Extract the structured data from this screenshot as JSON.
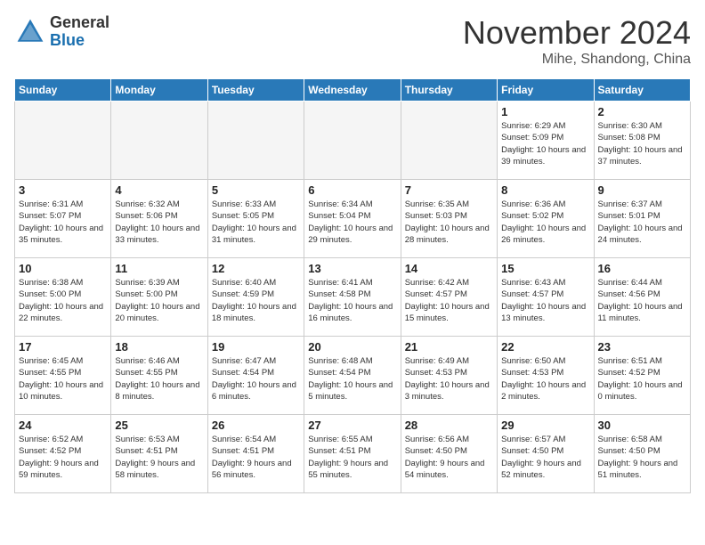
{
  "logo": {
    "general": "General",
    "blue": "Blue"
  },
  "header": {
    "month": "November 2024",
    "location": "Mihe, Shandong, China"
  },
  "days_of_week": [
    "Sunday",
    "Monday",
    "Tuesday",
    "Wednesday",
    "Thursday",
    "Friday",
    "Saturday"
  ],
  "weeks": [
    [
      {
        "day": "",
        "info": ""
      },
      {
        "day": "",
        "info": ""
      },
      {
        "day": "",
        "info": ""
      },
      {
        "day": "",
        "info": ""
      },
      {
        "day": "",
        "info": ""
      },
      {
        "day": "1",
        "info": "Sunrise: 6:29 AM\nSunset: 5:09 PM\nDaylight: 10 hours and 39 minutes."
      },
      {
        "day": "2",
        "info": "Sunrise: 6:30 AM\nSunset: 5:08 PM\nDaylight: 10 hours and 37 minutes."
      }
    ],
    [
      {
        "day": "3",
        "info": "Sunrise: 6:31 AM\nSunset: 5:07 PM\nDaylight: 10 hours and 35 minutes."
      },
      {
        "day": "4",
        "info": "Sunrise: 6:32 AM\nSunset: 5:06 PM\nDaylight: 10 hours and 33 minutes."
      },
      {
        "day": "5",
        "info": "Sunrise: 6:33 AM\nSunset: 5:05 PM\nDaylight: 10 hours and 31 minutes."
      },
      {
        "day": "6",
        "info": "Sunrise: 6:34 AM\nSunset: 5:04 PM\nDaylight: 10 hours and 29 minutes."
      },
      {
        "day": "7",
        "info": "Sunrise: 6:35 AM\nSunset: 5:03 PM\nDaylight: 10 hours and 28 minutes."
      },
      {
        "day": "8",
        "info": "Sunrise: 6:36 AM\nSunset: 5:02 PM\nDaylight: 10 hours and 26 minutes."
      },
      {
        "day": "9",
        "info": "Sunrise: 6:37 AM\nSunset: 5:01 PM\nDaylight: 10 hours and 24 minutes."
      }
    ],
    [
      {
        "day": "10",
        "info": "Sunrise: 6:38 AM\nSunset: 5:00 PM\nDaylight: 10 hours and 22 minutes."
      },
      {
        "day": "11",
        "info": "Sunrise: 6:39 AM\nSunset: 5:00 PM\nDaylight: 10 hours and 20 minutes."
      },
      {
        "day": "12",
        "info": "Sunrise: 6:40 AM\nSunset: 4:59 PM\nDaylight: 10 hours and 18 minutes."
      },
      {
        "day": "13",
        "info": "Sunrise: 6:41 AM\nSunset: 4:58 PM\nDaylight: 10 hours and 16 minutes."
      },
      {
        "day": "14",
        "info": "Sunrise: 6:42 AM\nSunset: 4:57 PM\nDaylight: 10 hours and 15 minutes."
      },
      {
        "day": "15",
        "info": "Sunrise: 6:43 AM\nSunset: 4:57 PM\nDaylight: 10 hours and 13 minutes."
      },
      {
        "day": "16",
        "info": "Sunrise: 6:44 AM\nSunset: 4:56 PM\nDaylight: 10 hours and 11 minutes."
      }
    ],
    [
      {
        "day": "17",
        "info": "Sunrise: 6:45 AM\nSunset: 4:55 PM\nDaylight: 10 hours and 10 minutes."
      },
      {
        "day": "18",
        "info": "Sunrise: 6:46 AM\nSunset: 4:55 PM\nDaylight: 10 hours and 8 minutes."
      },
      {
        "day": "19",
        "info": "Sunrise: 6:47 AM\nSunset: 4:54 PM\nDaylight: 10 hours and 6 minutes."
      },
      {
        "day": "20",
        "info": "Sunrise: 6:48 AM\nSunset: 4:54 PM\nDaylight: 10 hours and 5 minutes."
      },
      {
        "day": "21",
        "info": "Sunrise: 6:49 AM\nSunset: 4:53 PM\nDaylight: 10 hours and 3 minutes."
      },
      {
        "day": "22",
        "info": "Sunrise: 6:50 AM\nSunset: 4:53 PM\nDaylight: 10 hours and 2 minutes."
      },
      {
        "day": "23",
        "info": "Sunrise: 6:51 AM\nSunset: 4:52 PM\nDaylight: 10 hours and 0 minutes."
      }
    ],
    [
      {
        "day": "24",
        "info": "Sunrise: 6:52 AM\nSunset: 4:52 PM\nDaylight: 9 hours and 59 minutes."
      },
      {
        "day": "25",
        "info": "Sunrise: 6:53 AM\nSunset: 4:51 PM\nDaylight: 9 hours and 58 minutes."
      },
      {
        "day": "26",
        "info": "Sunrise: 6:54 AM\nSunset: 4:51 PM\nDaylight: 9 hours and 56 minutes."
      },
      {
        "day": "27",
        "info": "Sunrise: 6:55 AM\nSunset: 4:51 PM\nDaylight: 9 hours and 55 minutes."
      },
      {
        "day": "28",
        "info": "Sunrise: 6:56 AM\nSunset: 4:50 PM\nDaylight: 9 hours and 54 minutes."
      },
      {
        "day": "29",
        "info": "Sunrise: 6:57 AM\nSunset: 4:50 PM\nDaylight: 9 hours and 52 minutes."
      },
      {
        "day": "30",
        "info": "Sunrise: 6:58 AM\nSunset: 4:50 PM\nDaylight: 9 hours and 51 minutes."
      }
    ]
  ]
}
